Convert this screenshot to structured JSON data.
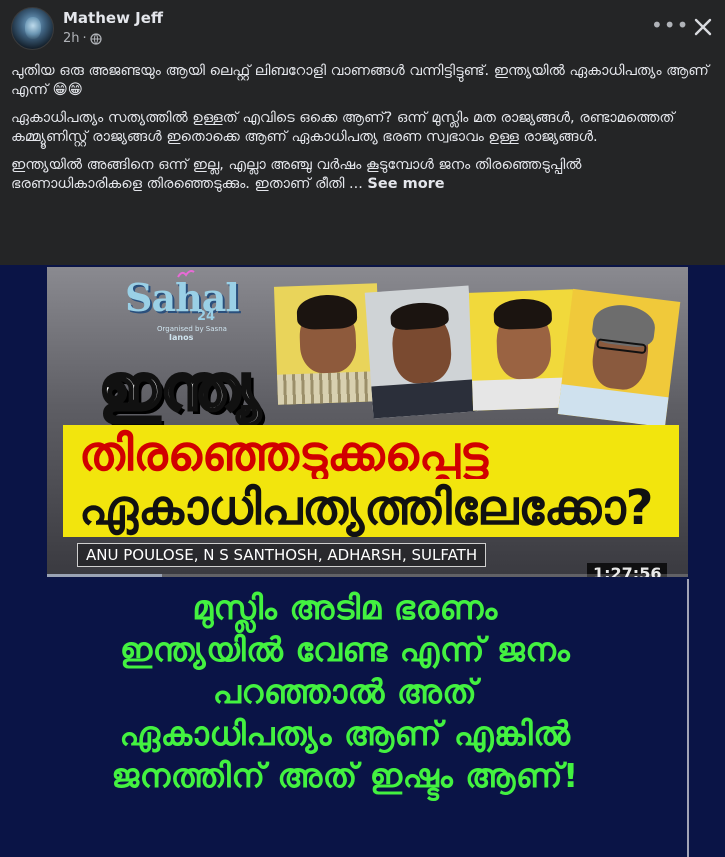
{
  "post": {
    "author": "Mathew Jeff",
    "time": "2h",
    "separator": "·",
    "visibility_icon": "globe-icon",
    "more_icon": "more-horizontal-icon",
    "close_icon": "close-icon",
    "more_label": "•••"
  },
  "text": {
    "para1": "പുതിയ ഒരു അജണ്ടയും ആയി ലെഫ്റ്റ് ലിബറോളി വാണങ്ങൾ വന്നിട്ടിട്ടുണ്ട്. ഇന്ത്യയിൽ ഏകാധിപത്യം ആണ് എന്ന് 😁😁",
    "para2": "ഏകാധിപത്യം സത്യത്തിൽ ഉള്ളത് എവിടെ ഒക്കെ ആണ്? ഒന്ന് മുസ്ലിം മത രാജ്യങ്ങൾ, രണ്ടാമത്തെത് കമ്മ്യൂണിസ്റ്റ് രാജ്യങ്ങൾ ഇതൊക്കെ ആണ് ഏകാധിപത്യ ഭരണ സ്വഭാവം ഉള്ള രാജ്യങ്ങൾ.",
    "para3": "ഇന്ത്യയിൽ അങ്ങിനെ ഒന്ന് ഇല്ല, എല്ലാ അഞ്ചു വർഷം കൂടുമ്പോൾ ജനം തിരഞ്ഞെടുപ്പിൽ ഭരണാധികാരികളെ തിരഞ്ഞെടുക്കും. ഇതാണ് രീതി ...",
    "see_more": "See more"
  },
  "video": {
    "logo_main": "Sahal",
    "logo_year": "24",
    "logo_org_line": "Organised by Sasna",
    "logo_org": "Ianos",
    "title_line1": "ഇന്ത്യ",
    "title_line2": "തിരഞ്ഞെടുക്കപ്പെട്ട",
    "title_line3": "ഏകാധിപത്യത്തിലേക്കോ?",
    "speakers": "ANU POULOSE, N S SANTHOSH, ADHARSH, SULFATH",
    "duration": "1:27:56",
    "progress_fraction": 0.18
  },
  "caption": {
    "line1": "മുസ്ലിം അടിമ ഭരണം",
    "line2": "ഇന്ത്യയിൽ വേണ്ട എന്ന് ജനം",
    "line3": "പറഞ്ഞാൽ അത്",
    "line4": "ഏകാധിപത്യം ആണ് എങ്കിൽ",
    "line5": "ജനത്തിന് അത് ഇഷ്ടം ആണ്!"
  },
  "colors": {
    "background": "#242526",
    "media_background": "#0a1446",
    "caption_text": "#43f240",
    "title_banner": "#f2e50d",
    "title_red": "#d10000"
  }
}
